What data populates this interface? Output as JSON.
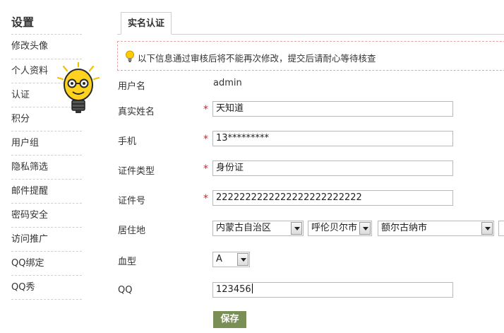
{
  "sidebar": {
    "title": "设置",
    "items": [
      {
        "label": "修改头像"
      },
      {
        "label": "个人资料"
      },
      {
        "label": "认证"
      },
      {
        "label": "积分"
      },
      {
        "label": "用户组"
      },
      {
        "label": "隐私筛选"
      },
      {
        "label": "邮件提醒"
      },
      {
        "label": "密码安全"
      },
      {
        "label": "访问推广"
      },
      {
        "label": "QQ绑定"
      },
      {
        "label": "QQ秀"
      }
    ]
  },
  "tab": {
    "label": "实名认证"
  },
  "notice": {
    "text": "以下信息通过审核后将不能再次修改，提交后请耐心等待核查",
    "icon": "lightbulb-icon"
  },
  "form": {
    "username_label": "用户名",
    "username_value": "admin",
    "realname_label": "真实姓名",
    "realname_value": "天知道",
    "phone_label": "手机",
    "phone_value": "13*********",
    "idtype_label": "证件类型",
    "idtype_value": "身份证",
    "idnumber_label": "证件号",
    "idnumber_value": "2222222222222222222222222",
    "residence_label": "居住地",
    "residence_province": "内蒙古自治区",
    "residence_city": "呼伦贝尔市",
    "residence_district": "额尔古纳市",
    "bloodtype_label": "血型",
    "bloodtype_value": "A",
    "qq_label": "QQ",
    "qq_value": "123456",
    "required_mark": "*",
    "save_label": "保存"
  },
  "colors": {
    "accent_button": "#7a8f55",
    "required": "#e02020",
    "notice_border": "#e6a3a3"
  }
}
